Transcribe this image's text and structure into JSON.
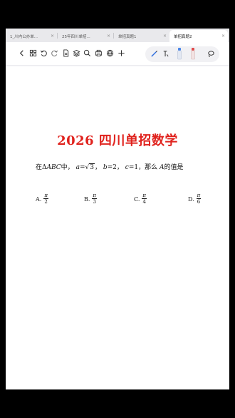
{
  "tabs": [
    {
      "label": "1_川内公办单...",
      "active": false
    },
    {
      "label": "25年四川单招...",
      "active": false
    },
    {
      "label": "单招真题1",
      "active": false
    },
    {
      "label": "单招真题2",
      "active": true
    }
  ],
  "toolbar": {
    "icons": [
      "back-icon",
      "grid-icon",
      "undo-icon",
      "redo-icon",
      "document-icon",
      "layers-icon",
      "search-icon",
      "print-icon",
      "globe-icon",
      "add-icon",
      "pen-icon",
      "text-select-icon",
      "marker-icon",
      "highlighter-icon",
      "lasso-icon"
    ]
  },
  "document": {
    "title": "2026 四川单招数学",
    "question": {
      "prefix": "在Δ",
      "triangle": "ABC",
      "mid1": "中，",
      "a_var": "a",
      "a_eq": "=",
      "a_root": "3",
      "sep1": "，",
      "b_var": "b",
      "b_eq": "=2",
      "sep2": "，",
      "c_var": "c",
      "c_eq": "=1",
      "sep3": "，那么",
      "angle": "A",
      "suffix": "的值是"
    },
    "options": [
      {
        "letter": "A.",
        "num": "π",
        "den": "2"
      },
      {
        "letter": "B.",
        "num": "π",
        "den": "3"
      },
      {
        "letter": "C.",
        "num": "π",
        "den": "4"
      },
      {
        "letter": "D.",
        "num": "π",
        "den": "6"
      }
    ]
  }
}
